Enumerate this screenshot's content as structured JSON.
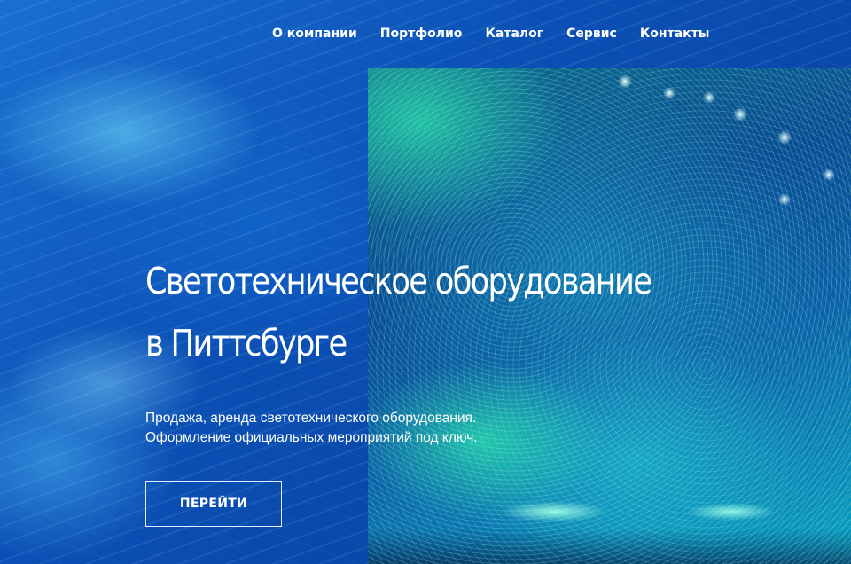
{
  "nav": {
    "items": [
      {
        "label": "О компании"
      },
      {
        "label": "Портфолио"
      },
      {
        "label": "Каталог"
      },
      {
        "label": "Сервис"
      },
      {
        "label": "Контакты"
      }
    ]
  },
  "hero": {
    "title_line1": "Светотехническое оборудование",
    "title_line2": "в Питтсбурге",
    "subtitle_line1": "Продажа, аренда светотехнического оборудования.",
    "subtitle_line2": "Оформление официальных мероприятий под ключ.",
    "cta_label": "ПЕРЕЙТИ"
  },
  "colors": {
    "background": "#0a4fb0",
    "text": "#ffffff",
    "accent_cyan": "#2be6aa"
  }
}
